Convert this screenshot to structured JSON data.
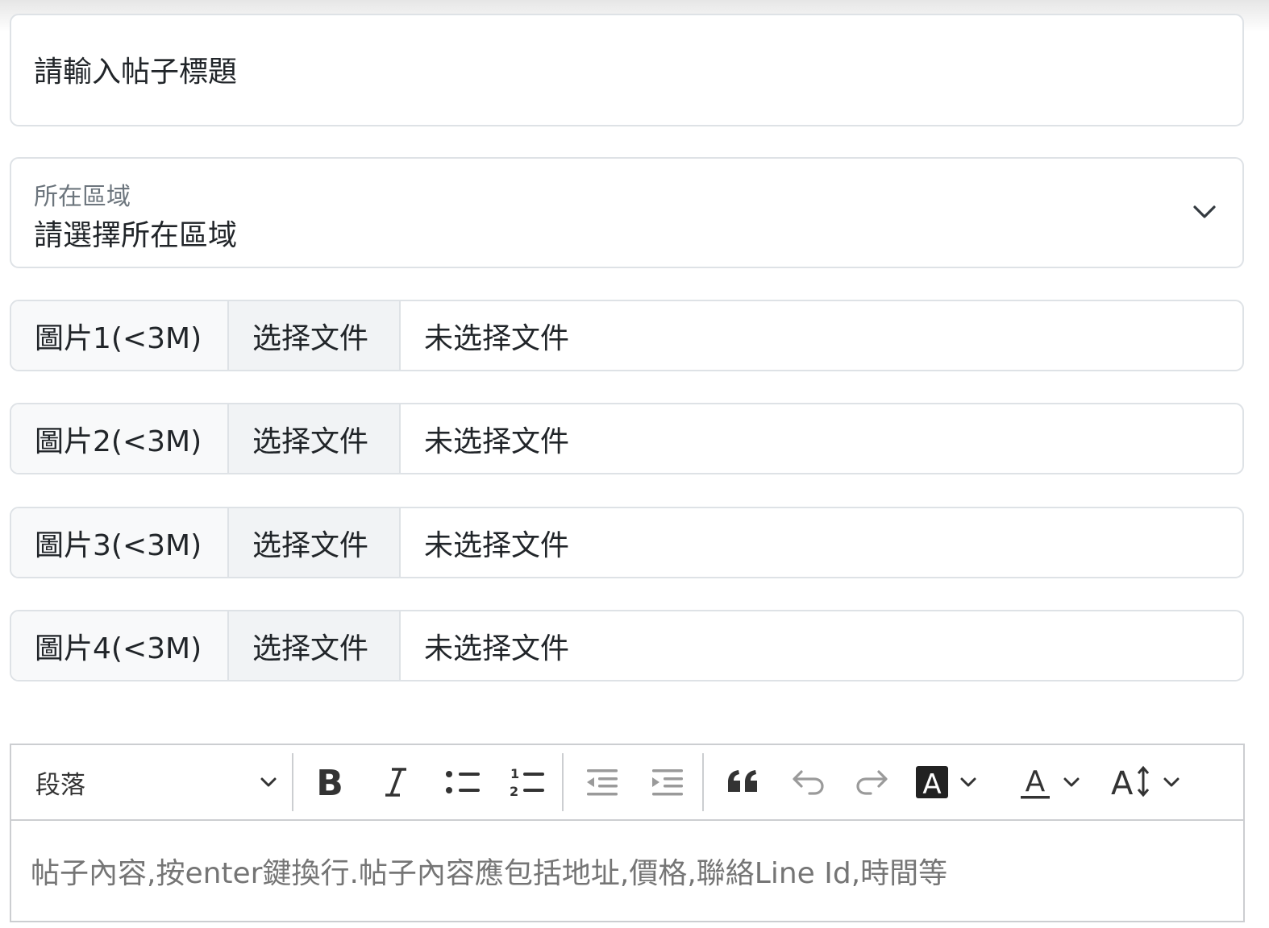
{
  "title_input": {
    "placeholder": "請輸入帖子標題",
    "value": ""
  },
  "region_select": {
    "label": "所在區域",
    "selected": "請選擇所在區域"
  },
  "image_uploads": [
    {
      "label": "圖片1(<3M)",
      "button": "选择文件",
      "status": "未选择文件"
    },
    {
      "label": "圖片2(<3M)",
      "button": "选择文件",
      "status": "未选择文件"
    },
    {
      "label": "圖片3(<3M)",
      "button": "选择文件",
      "status": "未选择文件"
    },
    {
      "label": "圖片4(<3M)",
      "button": "选择文件",
      "status": "未选择文件"
    }
  ],
  "editor": {
    "toolbar": {
      "heading_select": "段落",
      "icons": [
        "bold-icon",
        "italic-icon",
        "bulleted-list-icon",
        "numbered-list-icon",
        "outdent-icon",
        "indent-icon",
        "blockquote-icon",
        "undo-icon",
        "redo-icon",
        "font-background-color-icon",
        "font-color-icon",
        "font-size-icon"
      ]
    },
    "content_placeholder": "帖子內容,按enter鍵換行.帖子內容應包括地址,價格,聯絡Line Id,時間等"
  },
  "colors": {
    "border": "#dee2e6",
    "addon_bg": "#f8f9fa",
    "button_bg": "#f1f3f5",
    "placeholder": "#757575",
    "text": "#212529"
  }
}
